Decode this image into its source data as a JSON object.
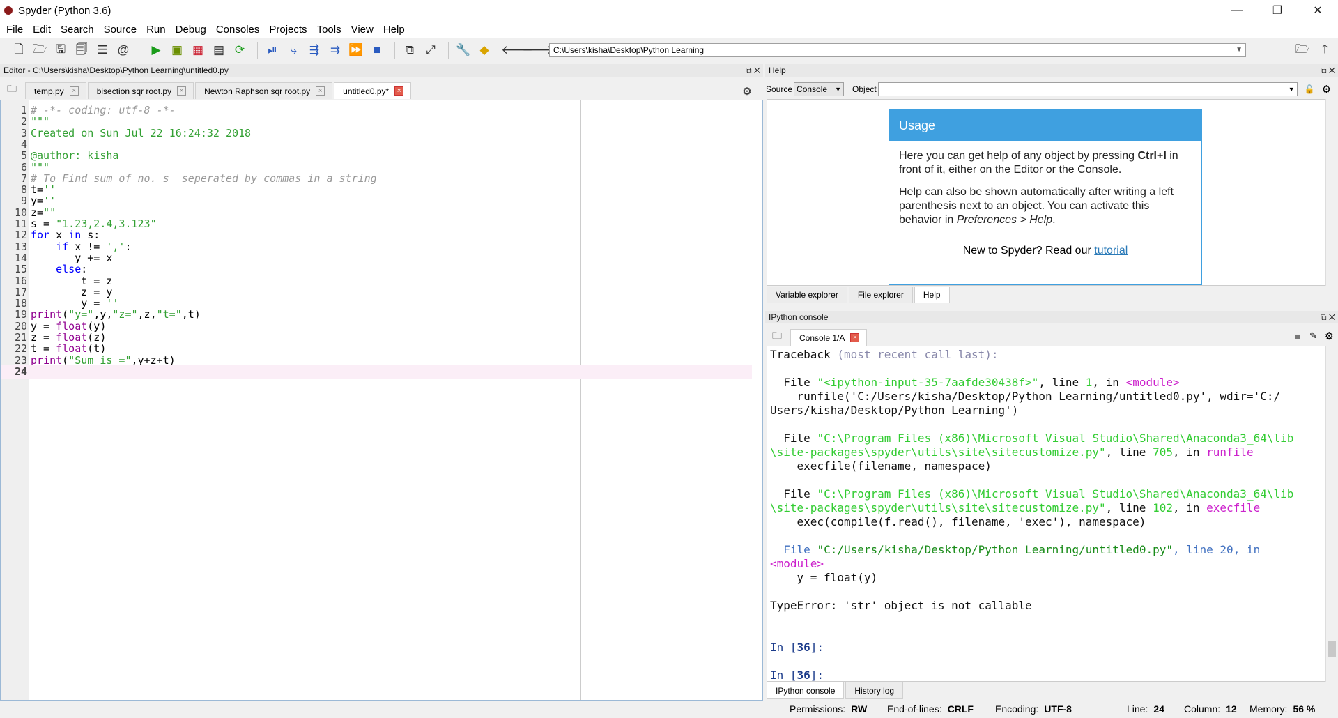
{
  "window": {
    "title": "Spyder (Python 3.6)",
    "minimize": "—",
    "maximize": "❐",
    "close": "✕"
  },
  "menu": [
    "File",
    "Edit",
    "Search",
    "Source",
    "Run",
    "Debug",
    "Consoles",
    "Projects",
    "Tools",
    "View",
    "Help"
  ],
  "path": {
    "value": "C:\\Users\\kisha\\Desktop\\Python Learning"
  },
  "editor": {
    "header": "Editor - C:\\Users\\kisha\\Desktop\\Python Learning\\untitled0.py",
    "tabs": [
      "temp.py",
      "bisection sqr root.py",
      "Newton Raphson sqr root.py",
      "untitled0.py*"
    ],
    "lines": [
      "# -*- coding: utf-8 -*-",
      "\"\"\"",
      "Created on Sun Jul 22 16:24:32 2018",
      "",
      "@author: kisha",
      "\"\"\"",
      "# To Find sum of no. s  seperated by commas in a string",
      "t=''",
      "y=''",
      "z=\"\"",
      "s = \"1.23,2.4,3.123\"",
      "for x in s:",
      "    if x != ',':",
      "       y += x",
      "    else:",
      "        t = z",
      "        z = y",
      "        y = ''",
      "print(\"y=\",y,\"z=\",z,\"t=\",t)",
      "y = float(y)",
      "z = float(z)",
      "t = float(t)",
      "print(\"Sum is =\",y+z+t)",
      "           "
    ]
  },
  "help": {
    "header": "Help",
    "source_label": "Source",
    "source_value": "Console",
    "object_label": "Object",
    "usage_title": "Usage",
    "usage_p1a": "Here you can get help of any object by pressing ",
    "usage_p1b": "Ctrl+I",
    "usage_p1c": " in front of it, either on the Editor or the Console.",
    "usage_p2a": "Help can also be shown automatically after writing a left parenthesis next to an object. You can activate this behavior in ",
    "usage_p2b": "Preferences > Help",
    "usage_p2c": ".",
    "usage_foot": "New to Spyder? Read our ",
    "usage_link": "tutorial",
    "bottom_tabs": [
      "Variable explorer",
      "File explorer",
      "Help"
    ]
  },
  "console": {
    "header": "IPython console",
    "tab": "Console 1/A",
    "traceback_head": "Traceback",
    "traceback_tail": "(most recent call last):",
    "f1_file": "File ",
    "f1_path": "\"<ipython-input-35-7aafde30438f>\"",
    "f1_line": ", line ",
    "f1_num": "1",
    "f1_in": ", in ",
    "f1_mod": "<module>",
    "f1_code": "    runfile('C:/Users/kisha/Desktop/Python Learning/untitled0.py', wdir='C:/",
    "f1_code2": "Users/kisha/Desktop/Python Learning')",
    "f2_path1": "\"C:\\Program Files (x86)\\Microsoft Visual Studio\\Shared\\Anaconda3_64\\lib",
    "f2_path2": "\\site-packages\\spyder\\utils\\site\\sitecustomize.py\"",
    "f2_num": "705",
    "f2_fn": "runfile",
    "f2_code": "    execfile(filename, namespace)",
    "f3_num": "102",
    "f3_fn": "execfile",
    "f3_code": "    exec(compile(f.read(), filename, 'exec'), namespace)",
    "f4_path": "\"C:/Users/kisha/Desktop/Python Learning/untitled0.py\"",
    "f4_num": "20",
    "f4_mod": "<module>",
    "f4_code": "    y = float(y)",
    "error": "TypeError: 'str' object is not callable",
    "prompt1": "In [",
    "prompt_num": "36",
    "prompt2": "]:",
    "bottom_tabs": [
      "IPython console",
      "History log"
    ]
  },
  "status": {
    "permissions_label": "Permissions:",
    "permissions": "RW",
    "eol_label": "End-of-lines:",
    "eol": "CRLF",
    "encoding_label": "Encoding:",
    "encoding": "UTF-8",
    "line_label": "Line:",
    "line": "24",
    "column_label": "Column:",
    "column": "12",
    "memory_label": "Memory:",
    "memory": "56 %"
  }
}
